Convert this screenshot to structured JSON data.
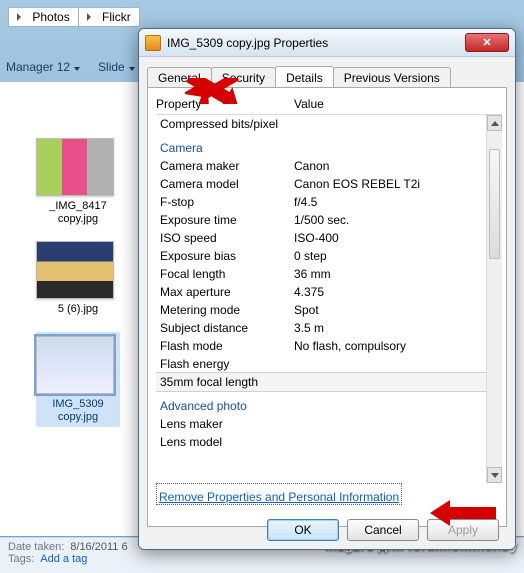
{
  "breadcrumb": {
    "a": "Photos",
    "b": "Flickr"
  },
  "toolbar": {
    "a": "Manager 12",
    "b": "Slide"
  },
  "thumbs": [
    {
      "name": "_IMG_8417 copy.jpg"
    },
    {
      "name": "5 (6).jpg"
    },
    {
      "name": "IMG_5309 copy.jpg"
    }
  ],
  "status": {
    "date_taken_label": "Date taken:",
    "date_taken_value": "8/16/2011 6",
    "tags_label": "Tags:",
    "tags_value": "Add a tag"
  },
  "watermark": "m1g2r3 для forum.onliner.by",
  "dialog": {
    "title": "IMG_5309 copy.jpg Properties",
    "tabs": {
      "general": "General",
      "security": "Security",
      "details": "Details",
      "previous": "Previous Versions"
    },
    "header": {
      "property": "Property",
      "value": "Value"
    },
    "rows": [
      {
        "k": "Compressed bits/pixel",
        "v": "",
        "type": "row"
      },
      {
        "k": "Camera",
        "v": "",
        "type": "group"
      },
      {
        "k": "Camera maker",
        "v": "Canon",
        "type": "row"
      },
      {
        "k": "Camera model",
        "v": "Canon EOS REBEL T2i",
        "type": "row"
      },
      {
        "k": "F-stop",
        "v": "f/4.5",
        "type": "row"
      },
      {
        "k": "Exposure time",
        "v": "1/500 sec.",
        "type": "row"
      },
      {
        "k": "ISO speed",
        "v": "ISO-400",
        "type": "row"
      },
      {
        "k": "Exposure bias",
        "v": "0 step",
        "type": "row"
      },
      {
        "k": "Focal length",
        "v": "36 mm",
        "type": "row"
      },
      {
        "k": "Max aperture",
        "v": "4.375",
        "type": "row"
      },
      {
        "k": "Metering mode",
        "v": "Spot",
        "type": "row"
      },
      {
        "k": "Subject distance",
        "v": "3.5 m",
        "type": "row"
      },
      {
        "k": "Flash mode",
        "v": "No flash, compulsory",
        "type": "row"
      },
      {
        "k": "Flash energy",
        "v": "",
        "type": "row"
      },
      {
        "k": "35mm focal length",
        "v": "",
        "type": "sel"
      },
      {
        "k": "Advanced photo",
        "v": "",
        "type": "group"
      },
      {
        "k": "Lens maker",
        "v": "",
        "type": "row"
      },
      {
        "k": "Lens model",
        "v": "",
        "type": "row"
      }
    ],
    "remove_link": "Remove Properties and Personal Information",
    "buttons": {
      "ok": "OK",
      "cancel": "Cancel",
      "apply": "Apply"
    }
  }
}
